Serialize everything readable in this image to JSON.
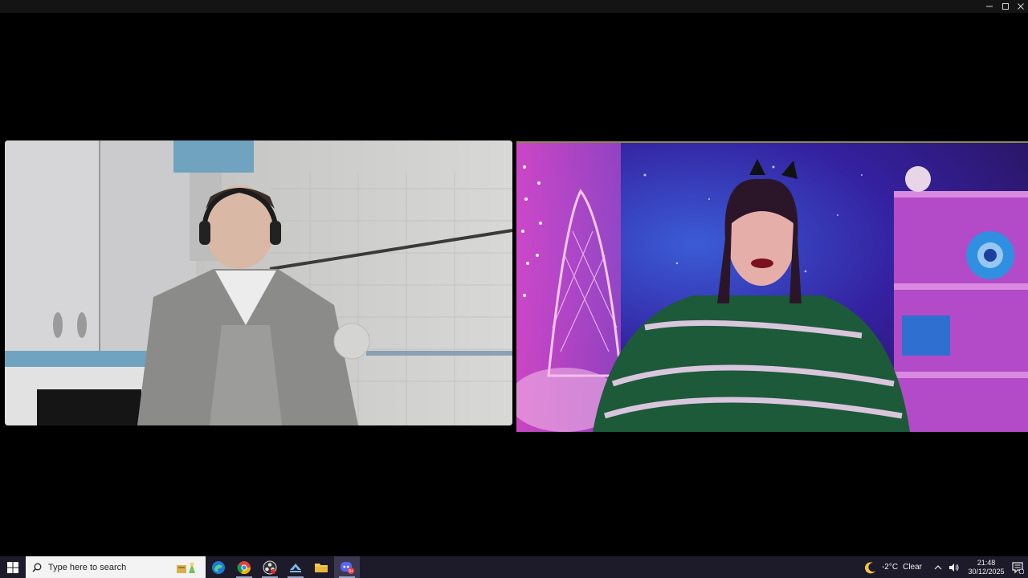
{
  "window": {
    "minimize_icon": "minimize-icon",
    "maximize_icon": "maximize-icon",
    "close_icon": "close-icon"
  },
  "video_tiles": [
    {
      "id": "participant-1",
      "description_icon": "webcam-feed"
    },
    {
      "id": "participant-2",
      "description_icon": "webcam-feed"
    }
  ],
  "taskbar": {
    "start_icon": "windows-logo-icon",
    "search": {
      "placeholder": "Type here to search",
      "icon": "search-icon"
    },
    "pinned_apps": [
      {
        "name": "news-widget",
        "icon": "news-icon"
      },
      {
        "name": "edge",
        "icon": "edge-icon"
      },
      {
        "name": "chrome",
        "icon": "chrome-icon"
      },
      {
        "name": "obs",
        "icon": "obs-icon"
      },
      {
        "name": "steam",
        "icon": "steam-icon"
      },
      {
        "name": "file-explorer",
        "icon": "folder-icon"
      },
      {
        "name": "discord",
        "icon": "discord-icon"
      }
    ],
    "weather": {
      "temperature": "-2°C",
      "condition": "Clear",
      "icon": "moon-icon"
    },
    "clock": {
      "time": "21:48",
      "date": "30/12/2025"
    },
    "colors": {
      "taskbar_bg": "#1d1b2a",
      "search_bg": "#f3f3f3"
    }
  }
}
